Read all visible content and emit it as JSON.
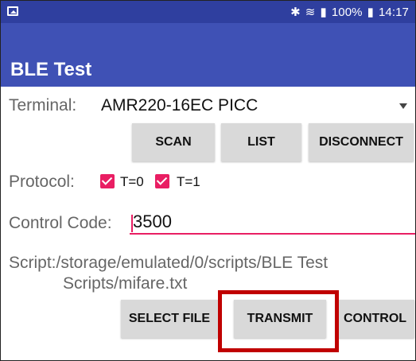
{
  "status_bar": {
    "battery": "100%",
    "time": "14:17"
  },
  "app_bar": {
    "title": "BLE Test"
  },
  "terminal": {
    "label": "Terminal:",
    "selected": "AMR220-16EC PICC"
  },
  "actions": {
    "scan": "SCAN",
    "list": "LIST",
    "disconnect": "DISCONNECT"
  },
  "protocol": {
    "label": "Protocol:",
    "t0": "T=0",
    "t1": "T=1"
  },
  "control": {
    "label": "Control Code:",
    "value": "3500"
  },
  "script": {
    "line1": "Script:/storage/emulated/0/scripts/BLE Test",
    "line2": "Scripts/mifare.txt"
  },
  "bottom": {
    "select_file": "SELECT FILE",
    "transmit": "TRANSMIT",
    "control": "CONTROL"
  },
  "colors": {
    "status_bar": "#2f3f9f",
    "app_bar": "#3f51b5",
    "accent": "#e91e63",
    "button_bg": "#d9d9d9",
    "highlight": "#c00000"
  }
}
